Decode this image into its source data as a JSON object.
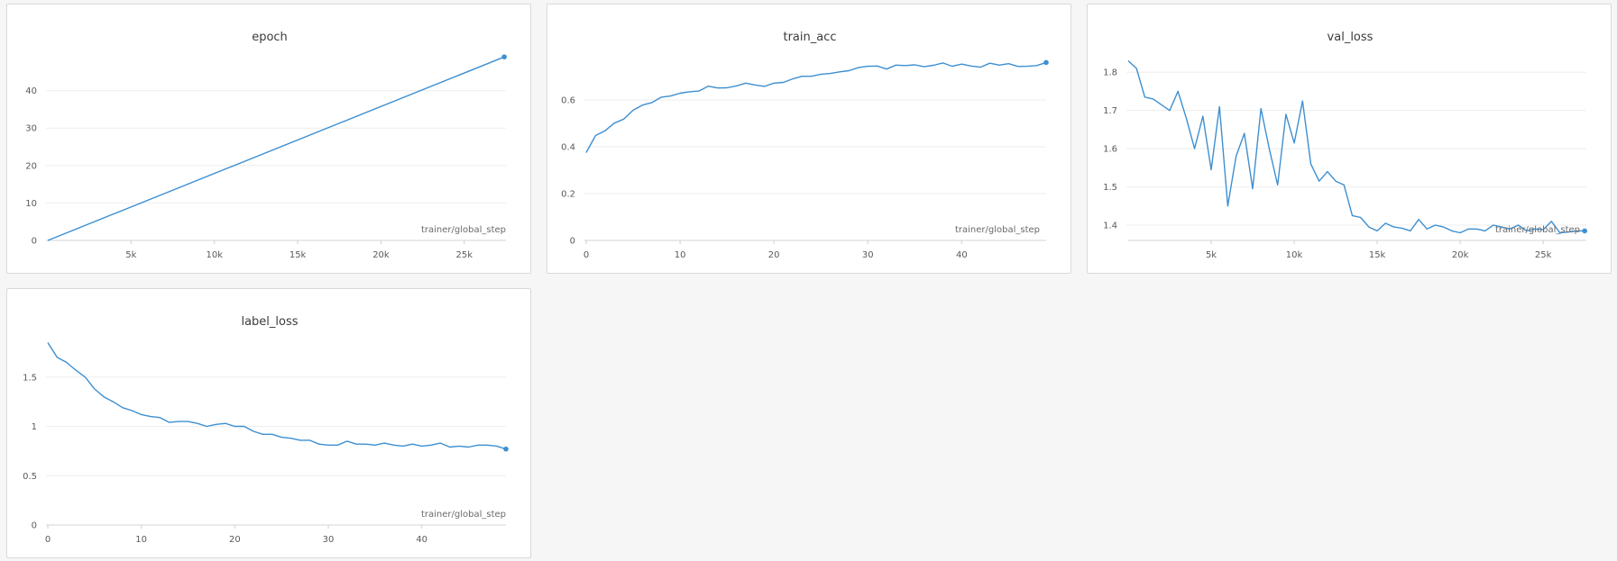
{
  "chart_data": [
    {
      "type": "line",
      "title": "epoch",
      "xlabel": "trainer/global_step",
      "ylabel": "",
      "xlim": [
        0,
        27500
      ],
      "ylim": [
        0,
        50
      ],
      "xticks": [
        5000,
        10000,
        15000,
        20000,
        25000
      ],
      "xtick_labels": [
        "5k",
        "10k",
        "15k",
        "20k",
        "25k"
      ],
      "yticks": [
        0,
        10,
        20,
        30,
        40
      ],
      "ytick_labels": [
        "0",
        "10",
        "20",
        "30",
        "40"
      ],
      "grid": true,
      "color": "#3d8fd1",
      "series": [
        {
          "x": [
            0,
            27400
          ],
          "y": [
            0,
            49
          ]
        }
      ]
    },
    {
      "type": "line",
      "title": "train_acc",
      "xlabel": "trainer/global_step",
      "ylabel": "",
      "xlim": [
        0,
        49
      ],
      "ylim": [
        0,
        0.8
      ],
      "xticks": [
        0,
        10,
        20,
        30,
        40
      ],
      "xtick_labels": [
        "0",
        "10",
        "20",
        "30",
        "40"
      ],
      "yticks": [
        0,
        0.2,
        0.4,
        0.6
      ],
      "ytick_labels": [
        "0",
        "0.2",
        "0.4",
        "0.6"
      ],
      "grid": true,
      "color": "#3d8fd1",
      "series": [
        {
          "x": [
            0,
            1,
            2,
            3,
            4,
            5,
            6,
            7,
            8,
            9,
            10,
            11,
            12,
            13,
            14,
            15,
            16,
            17,
            18,
            19,
            20,
            21,
            22,
            23,
            24,
            25,
            26,
            27,
            28,
            29,
            30,
            31,
            32,
            33,
            34,
            35,
            36,
            37,
            38,
            39,
            40,
            41,
            42,
            43,
            44,
            45,
            46,
            47,
            48,
            49
          ],
          "y": [
            0.375,
            0.448,
            0.468,
            0.501,
            0.518,
            0.556,
            0.578,
            0.589,
            0.612,
            0.617,
            0.629,
            0.635,
            0.638,
            0.659,
            0.651,
            0.652,
            0.66,
            0.672,
            0.664,
            0.658,
            0.672,
            0.675,
            0.69,
            0.701,
            0.701,
            0.71,
            0.713,
            0.72,
            0.725,
            0.738,
            0.744,
            0.745,
            0.732,
            0.749,
            0.747,
            0.75,
            0.742,
            0.748,
            0.758,
            0.744,
            0.753,
            0.745,
            0.74,
            0.757,
            0.749,
            0.755,
            0.743,
            0.744,
            0.747,
            0.76
          ]
        }
      ]
    },
    {
      "type": "line",
      "title": "val_loss",
      "xlabel": "trainer/global_step",
      "ylabel": "",
      "xlim": [
        0,
        27600
      ],
      "ylim": [
        1.36,
        1.85
      ],
      "xticks": [
        5000,
        10000,
        15000,
        20000,
        25000
      ],
      "xtick_labels": [
        "5k",
        "10k",
        "15k",
        "20k",
        "25k"
      ],
      "yticks": [
        1.4,
        1.5,
        1.6,
        1.7,
        1.8
      ],
      "ytick_labels": [
        "1.4",
        "1.5",
        "1.6",
        "1.7",
        "1.8"
      ],
      "grid": true,
      "color": "#3d8fd1",
      "series": [
        {
          "x": [
            0,
            500,
            1000,
            1500,
            2000,
            2500,
            3000,
            3500,
            4000,
            4500,
            5000,
            5500,
            6000,
            6500,
            7000,
            7500,
            8000,
            8500,
            9000,
            9500,
            10000,
            10500,
            11000,
            11500,
            12000,
            12500,
            13000,
            13500,
            14000,
            14500,
            15000,
            15500,
            16000,
            16500,
            17000,
            17500,
            18000,
            18500,
            19000,
            19500,
            20000,
            20500,
            21000,
            21500,
            22000,
            22500,
            23000,
            23500,
            24000,
            24500,
            25000,
            25500,
            26000,
            26500,
            27000,
            27500
          ],
          "y": [
            1.83,
            1.81,
            1.735,
            1.73,
            1.715,
            1.7,
            1.75,
            1.68,
            1.6,
            1.685,
            1.545,
            1.71,
            1.45,
            1.58,
            1.64,
            1.495,
            1.705,
            1.6,
            1.505,
            1.69,
            1.615,
            1.725,
            1.56,
            1.515,
            1.54,
            1.515,
            1.505,
            1.425,
            1.42,
            1.395,
            1.385,
            1.405,
            1.395,
            1.392,
            1.385,
            1.415,
            1.39,
            1.4,
            1.395,
            1.385,
            1.38,
            1.39,
            1.39,
            1.385,
            1.4,
            1.395,
            1.39,
            1.4,
            1.385,
            1.39,
            1.388,
            1.41,
            1.38,
            1.382,
            1.385,
            1.385
          ]
        }
      ]
    },
    {
      "type": "line",
      "title": "label_loss",
      "xlabel": "trainer/global_step",
      "ylabel": "",
      "xlim": [
        0,
        49
      ],
      "ylim": [
        0,
        1.9
      ],
      "xticks": [
        0,
        10,
        20,
        30,
        40
      ],
      "xtick_labels": [
        "0",
        "10",
        "20",
        "30",
        "40"
      ],
      "yticks": [
        0,
        0.5,
        1,
        1.5
      ],
      "ytick_labels": [
        "0",
        "0.5",
        "1",
        "1.5"
      ],
      "grid": true,
      "color": "#3d8fd1",
      "series": [
        {
          "x": [
            0,
            1,
            2,
            3,
            4,
            5,
            6,
            7,
            8,
            9,
            10,
            11,
            12,
            13,
            14,
            15,
            16,
            17,
            18,
            19,
            20,
            21,
            22,
            23,
            24,
            25,
            26,
            27,
            28,
            29,
            30,
            31,
            32,
            33,
            34,
            35,
            36,
            37,
            38,
            39,
            40,
            41,
            42,
            43,
            44,
            45,
            46,
            47,
            48,
            49
          ],
          "y": [
            1.85,
            1.7,
            1.65,
            1.57,
            1.5,
            1.38,
            1.3,
            1.25,
            1.19,
            1.16,
            1.12,
            1.1,
            1.09,
            1.04,
            1.05,
            1.05,
            1.03,
            1.0,
            1.02,
            1.03,
            1.0,
            1.0,
            0.95,
            0.92,
            0.92,
            0.89,
            0.88,
            0.86,
            0.86,
            0.82,
            0.81,
            0.81,
            0.85,
            0.82,
            0.82,
            0.81,
            0.83,
            0.81,
            0.8,
            0.82,
            0.8,
            0.81,
            0.83,
            0.79,
            0.8,
            0.79,
            0.81,
            0.81,
            0.8,
            0.77
          ]
        }
      ]
    }
  ]
}
